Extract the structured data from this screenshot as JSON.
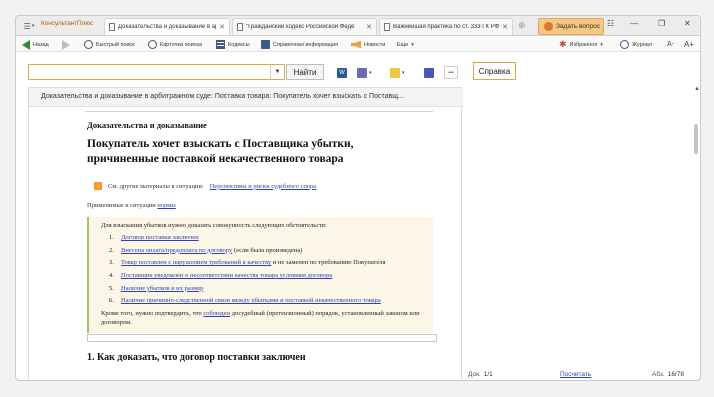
{
  "brand": "КонсультантПлюс",
  "tabs": [
    {
      "title": "Доказательства и доказывание в арбитр",
      "active": true
    },
    {
      "title": "\"Гражданский кодекс Российской Феде",
      "active": false
    },
    {
      "title": "Важнейшая практика по ст. 333 ГК РФ",
      "active": false
    }
  ],
  "ask_button": "Задать вопрос",
  "toolbar": {
    "back": "Назад",
    "quick_search": "Быстрый поиск",
    "search_card": "Карточка поиска",
    "codes": "Кодексы",
    "reference": "Справочная информация",
    "news": "Новости",
    "more": "Еще",
    "favorites": "Избранное",
    "journal": "Журнал",
    "font_down": "A-",
    "font_up": "A+"
  },
  "search": {
    "value": "",
    "find_button": "Найти",
    "help_button": "Справка"
  },
  "document": {
    "header": "Доказательства и доказывание в арбитражном суде: Поставка товара: Покупатель хочет взыскать с Поставщ...",
    "section_label": "Доказательства и доказывание",
    "title_line1": "Покупатель хочет взыскать с Поставщика убытки,",
    "title_line2": "причиненные поставкой некачественного товара",
    "see_also_prefix": "См. другие материалы к ситуации:",
    "see_also_link": "Перспективы и риски судебного спора",
    "applied_prefix": "Применимые к ситуации",
    "applied_link": "нормы",
    "callout_intro": "Для взыскания убытков нужно доказать совокупность следующих обстоятельств:",
    "items": [
      {
        "num": "1.",
        "link": "Договор поставки заключен",
        "rest": ""
      },
      {
        "num": "2.",
        "link": "Внесена оплата/предоплата по договору",
        "rest": " (если была произведена)"
      },
      {
        "num": "3.",
        "link": "Товар поставлен с нарушением требований к качеству",
        "rest": " и не заменен по требованию Покупателя"
      },
      {
        "num": "4.",
        "link": "Поставщик уведомлен о несоответствии качества товара условиям договора",
        "rest": ""
      },
      {
        "num": "5.",
        "link": "Наличие убытков и их размер",
        "rest": ""
      },
      {
        "num": "6.",
        "link": "Наличие причинно-следственной связи между убытками и поставкой некачественного товара",
        "rest": ""
      }
    ],
    "also_prefix": "Кроме того, нужно подтвердить, что",
    "also_link": "соблюден",
    "also_suffix": "досудебный (претензионный) порядок, установленный законом или договором.",
    "heading1": "1. Как доказать, что договор поставки заключен"
  },
  "status": {
    "doc_label": "Док.",
    "doc_value": "1/1",
    "count_link": "Посчитать",
    "par_label": "Абз.",
    "par_value": "16/78"
  }
}
